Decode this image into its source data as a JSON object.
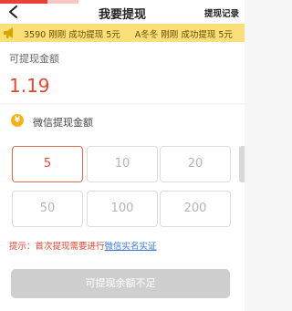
{
  "header": {
    "title": "我要提现",
    "record_link": "提现记录"
  },
  "marquee": {
    "items": [
      "3590 刚刚 成功提现 5元",
      "A冬冬 刚刚 成功提现 5元"
    ]
  },
  "balance": {
    "label": "可提现金额",
    "value": "1.19"
  },
  "method": {
    "icon_glyph": "¥",
    "label": "微信提现金额"
  },
  "amounts": {
    "options": [
      "5",
      "10",
      "20",
      "50",
      "100",
      "200"
    ],
    "selected": "5"
  },
  "hint": {
    "prefix": "提示：首次提现需要进行",
    "link": "微信实名实证"
  },
  "submit": {
    "label": "可提现余额不足"
  },
  "colors": {
    "accent": "#e0482f",
    "marquee_bg": "#fbe07a",
    "link": "#3a7bd5",
    "disabled_btn": "#cfcfcf"
  }
}
